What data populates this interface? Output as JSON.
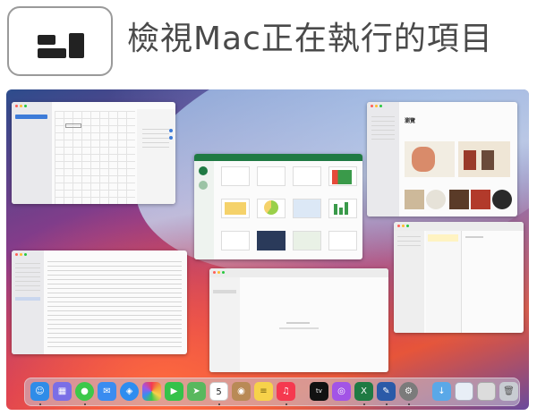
{
  "header": {
    "title": "檢視Mac正在執行的項目",
    "icon": "mission-control-icon"
  },
  "desktop": {
    "wallpaper_colors": [
      "#2d4c8c",
      "#8f3a8a",
      "#d2335a",
      "#e6553a",
      "#9bbbe6"
    ]
  },
  "music_window": {
    "heading": "瀏覽"
  },
  "calendar_icon": {
    "date": "5"
  },
  "dock": {
    "apps": [
      {
        "name": "finder-icon",
        "color": "#2f8ce8"
      },
      {
        "name": "launchpad-icon",
        "color": "#7a6ee6"
      },
      {
        "name": "messages-icon",
        "color": "#3cc84a"
      },
      {
        "name": "mail-icon",
        "color": "#3a8cf0"
      },
      {
        "name": "safari-icon",
        "color": "#2e8df0"
      },
      {
        "name": "photos-icon",
        "color": "#f2a03a"
      },
      {
        "name": "facetime-icon",
        "color": "#35c24a"
      },
      {
        "name": "maps-icon",
        "color": "#58b85e"
      },
      {
        "name": "calendar-icon",
        "color": "#ffffff"
      },
      {
        "name": "contacts-icon",
        "color": "#b98a56"
      },
      {
        "name": "notes-icon",
        "color": "#f7d24a"
      },
      {
        "name": "music-icon",
        "color": "#f5394f"
      },
      {
        "name": "tv-icon",
        "color": "#111111"
      },
      {
        "name": "podcasts-icon",
        "color": "#a254e6"
      },
      {
        "name": "excel-icon",
        "color": "#1f7a43"
      },
      {
        "name": "keynote-icon",
        "color": "#2b5aa8"
      },
      {
        "name": "system-preferences-icon",
        "color": "#7b7b7b"
      },
      {
        "name": "downloads-folder-icon",
        "color": "#5aa8e8"
      },
      {
        "name": "screenshot-icon",
        "color": "#e8eef6"
      },
      {
        "name": "document-icon",
        "color": "#dcdcdc"
      },
      {
        "name": "trash-icon",
        "color": "#c8ccd2"
      }
    ]
  }
}
